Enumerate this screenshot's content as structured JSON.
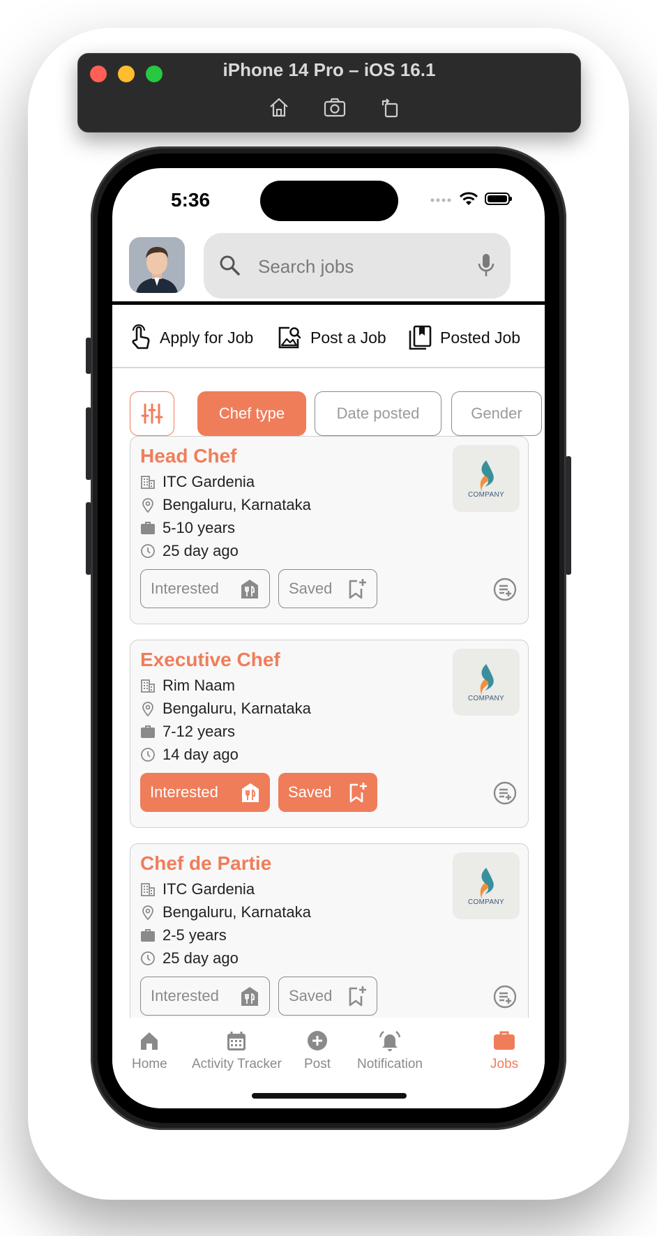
{
  "simulator": {
    "title": "iPhone 14 Pro – iOS 16.1",
    "controls": [
      "home-icon",
      "screenshot-icon",
      "rotate-icon"
    ]
  },
  "status_bar": {
    "time": "5:36"
  },
  "search": {
    "placeholder": "Search jobs"
  },
  "quick_actions": [
    {
      "label": "Apply for Job",
      "icon": "tap-hand-icon"
    },
    {
      "label": "Post a Job",
      "icon": "image-search-icon"
    },
    {
      "label": "Posted Job",
      "icon": "book-bookmark-icon"
    }
  ],
  "filters": {
    "chips": [
      "Chef type",
      "Date posted",
      "Gender"
    ],
    "active": "Chef type"
  },
  "jobs": [
    {
      "title": "Head Chef",
      "company": "ITC Gardenia",
      "location": "Bengaluru, Karnataka",
      "experience": "5-10 years",
      "posted": "25 day ago",
      "interested_label": "Interested",
      "saved_label": "Saved",
      "interested": false,
      "saved": false,
      "logo_text": "COMPANY"
    },
    {
      "title": "Executive Chef",
      "company": "Rim Naam",
      "location": "Bengaluru, Karnataka",
      "experience": "7-12 years",
      "posted": "14 day ago",
      "interested_label": "Interested",
      "saved_label": "Saved",
      "interested": true,
      "saved": true,
      "logo_text": "COMPANY"
    },
    {
      "title": "Chef de Partie",
      "company": "ITC Gardenia",
      "location": "Bengaluru, Karnataka",
      "experience": "2-5 years",
      "posted": "25 day ago",
      "interested_label": "Interested",
      "saved_label": "Saved",
      "interested": false,
      "saved": false,
      "logo_text": "COMPANY"
    }
  ],
  "tabbar": {
    "items": [
      {
        "label": "Home",
        "icon": "home-icon"
      },
      {
        "label": "Activity Tracker",
        "icon": "calendar-icon"
      },
      {
        "label": "Post",
        "icon": "plus-circle-icon"
      },
      {
        "label": "Notification",
        "icon": "bell-icon"
      },
      {
        "label": "Jobs",
        "icon": "briefcase-icon"
      }
    ],
    "active": "Jobs"
  },
  "colors": {
    "accent": "#f07d5a",
    "muted": "#8a8a8a",
    "search_bg": "#e5e5e5"
  }
}
